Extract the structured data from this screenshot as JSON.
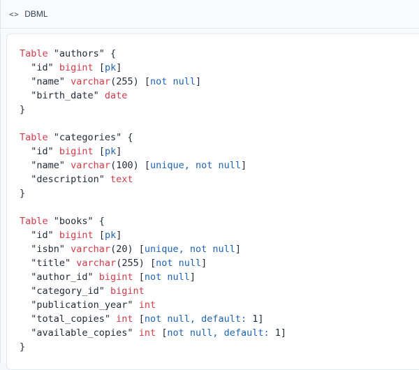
{
  "header": {
    "icon": "code-icon",
    "language": "DBML",
    "icon_text": "<>"
  },
  "code": {
    "lines": [
      [
        {
          "t": "kw",
          "v": "Table"
        },
        {
          "t": "str",
          "v": " \"authors\" {"
        }
      ],
      [
        {
          "t": "str",
          "v": "  \"id\" "
        },
        {
          "t": "type",
          "v": "bigint"
        },
        {
          "t": "br",
          "v": " ["
        },
        {
          "t": "attr",
          "v": "pk"
        },
        {
          "t": "br",
          "v": "]"
        }
      ],
      [
        {
          "t": "str",
          "v": "  \"name\" "
        },
        {
          "t": "type",
          "v": "varchar"
        },
        {
          "t": "br",
          "v": "("
        },
        {
          "t": "num",
          "v": "255"
        },
        {
          "t": "br",
          "v": ") ["
        },
        {
          "t": "attr",
          "v": "not null"
        },
        {
          "t": "br",
          "v": "]"
        }
      ],
      [
        {
          "t": "str",
          "v": "  \"birth_date\" "
        },
        {
          "t": "type",
          "v": "date"
        }
      ],
      [
        {
          "t": "br",
          "v": "}"
        }
      ],
      [],
      [
        {
          "t": "kw",
          "v": "Table"
        },
        {
          "t": "str",
          "v": " \"categories\" {"
        }
      ],
      [
        {
          "t": "str",
          "v": "  \"id\" "
        },
        {
          "t": "type",
          "v": "bigint"
        },
        {
          "t": "br",
          "v": " ["
        },
        {
          "t": "attr",
          "v": "pk"
        },
        {
          "t": "br",
          "v": "]"
        }
      ],
      [
        {
          "t": "str",
          "v": "  \"name\" "
        },
        {
          "t": "type",
          "v": "varchar"
        },
        {
          "t": "br",
          "v": "("
        },
        {
          "t": "num",
          "v": "100"
        },
        {
          "t": "br",
          "v": ") ["
        },
        {
          "t": "attr",
          "v": "unique, not null"
        },
        {
          "t": "br",
          "v": "]"
        }
      ],
      [
        {
          "t": "str",
          "v": "  \"description\" "
        },
        {
          "t": "type",
          "v": "text"
        }
      ],
      [
        {
          "t": "br",
          "v": "}"
        }
      ],
      [],
      [
        {
          "t": "kw",
          "v": "Table"
        },
        {
          "t": "str",
          "v": " \"books\" {"
        }
      ],
      [
        {
          "t": "str",
          "v": "  \"id\" "
        },
        {
          "t": "type",
          "v": "bigint"
        },
        {
          "t": "br",
          "v": " ["
        },
        {
          "t": "attr",
          "v": "pk"
        },
        {
          "t": "br",
          "v": "]"
        }
      ],
      [
        {
          "t": "str",
          "v": "  \"isbn\" "
        },
        {
          "t": "type",
          "v": "varchar"
        },
        {
          "t": "br",
          "v": "("
        },
        {
          "t": "num",
          "v": "20"
        },
        {
          "t": "br",
          "v": ") ["
        },
        {
          "t": "attr",
          "v": "unique, not null"
        },
        {
          "t": "br",
          "v": "]"
        }
      ],
      [
        {
          "t": "str",
          "v": "  \"title\" "
        },
        {
          "t": "type",
          "v": "varchar"
        },
        {
          "t": "br",
          "v": "("
        },
        {
          "t": "num",
          "v": "255"
        },
        {
          "t": "br",
          "v": ") ["
        },
        {
          "t": "attr",
          "v": "not null"
        },
        {
          "t": "br",
          "v": "]"
        }
      ],
      [
        {
          "t": "str",
          "v": "  \"author_id\" "
        },
        {
          "t": "type",
          "v": "bigint"
        },
        {
          "t": "br",
          "v": " ["
        },
        {
          "t": "attr",
          "v": "not null"
        },
        {
          "t": "br",
          "v": "]"
        }
      ],
      [
        {
          "t": "str",
          "v": "  \"category_id\" "
        },
        {
          "t": "type",
          "v": "bigint"
        }
      ],
      [
        {
          "t": "str",
          "v": "  \"publication_year\" "
        },
        {
          "t": "type",
          "v": "int"
        }
      ],
      [
        {
          "t": "str",
          "v": "  \"total_copies\" "
        },
        {
          "t": "type",
          "v": "int"
        },
        {
          "t": "br",
          "v": " ["
        },
        {
          "t": "attr",
          "v": "not null, default: "
        },
        {
          "t": "num",
          "v": "1"
        },
        {
          "t": "br",
          "v": "]"
        }
      ],
      [
        {
          "t": "str",
          "v": "  \"available_copies\" "
        },
        {
          "t": "type",
          "v": "int"
        },
        {
          "t": "br",
          "v": " ["
        },
        {
          "t": "attr",
          "v": "not null, default: "
        },
        {
          "t": "num",
          "v": "1"
        },
        {
          "t": "br",
          "v": "]"
        }
      ],
      [
        {
          "t": "br",
          "v": "}"
        }
      ]
    ]
  },
  "colors": {
    "keyword": "#d73a49",
    "attribute": "#1d63b8",
    "text": "#1f2937"
  }
}
